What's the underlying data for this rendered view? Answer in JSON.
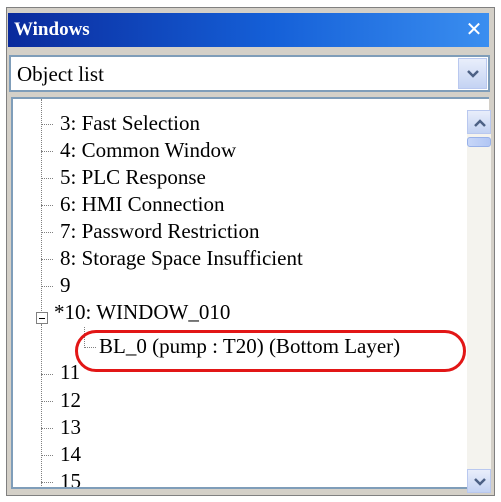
{
  "window": {
    "title": "Windows"
  },
  "dropdown": {
    "value": "Object list"
  },
  "tree": {
    "items": [
      {
        "label": "3: Fast Selection"
      },
      {
        "label": "4: Common Window"
      },
      {
        "label": "5: PLC Response"
      },
      {
        "label": "6: HMI Connection"
      },
      {
        "label": "7: Password Restriction"
      },
      {
        "label": "8: Storage Space Insufficient"
      },
      {
        "label": "9"
      },
      {
        "label": "*10: WINDOW_010"
      },
      {
        "label": "BL_0 (pump : T20) (Bottom Layer)"
      },
      {
        "label": "11"
      },
      {
        "label": "12"
      },
      {
        "label": "13"
      },
      {
        "label": "14"
      },
      {
        "label": "15"
      }
    ]
  },
  "annotation": {
    "color": "#e21616"
  }
}
